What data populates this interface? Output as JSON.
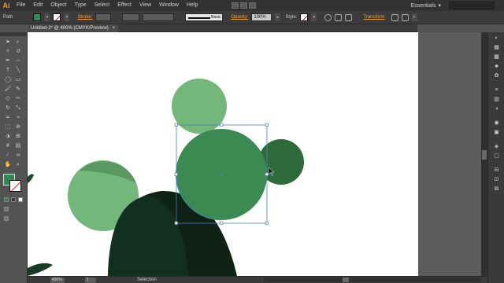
{
  "app": {
    "logo": "Ai"
  },
  "menu": {
    "items": [
      "File",
      "Edit",
      "Object",
      "Type",
      "Select",
      "Effect",
      "View",
      "Window",
      "Help"
    ]
  },
  "workspace": {
    "label": "Essentials",
    "arrow": "▾"
  },
  "control_bar": {
    "selection_type": "Path",
    "stroke_label": "Stroke:",
    "brush_label": "Basic",
    "opacity_label": "Opacity:",
    "opacity_value": "100%",
    "style_label": "Style:",
    "transform_label": "Transform",
    "fill_color": "#2f8a51"
  },
  "document": {
    "tab_title": "Untitled-2* @ 400% (CMYK/Preview)",
    "close_glyph": "×"
  },
  "status": {
    "zoom": "400%",
    "page": "1",
    "tool": "Selection"
  },
  "colors": {
    "light_green": "#74b77a",
    "mid_green": "#3a8a52",
    "dark_green": "#2e6b3a",
    "very_dark_green": "#0f2216",
    "dark_band": "#123020",
    "selection_blue": "#4a7fc1"
  },
  "icons": {
    "tools": [
      "selection-tool-icon",
      "direct-selection-tool-icon",
      "magic-wand-icon",
      "lasso-icon",
      "pen-icon",
      "curvature-icon",
      "type-icon",
      "line-icon",
      "ellipse-icon",
      "rectangle-icon",
      "paintbrush-icon",
      "pencil-icon",
      "eraser-icon",
      "scissors-icon",
      "rotate-icon",
      "scale-icon",
      "width-icon",
      "warp-icon",
      "free-transform-icon",
      "shape-builder-icon",
      "live-paint-icon",
      "perspective-icon",
      "mesh-icon",
      "gradient-icon",
      "eyedropper-icon",
      "blend-icon",
      "symbol-sprayer-icon",
      "graph-icon",
      "artboard-icon",
      "slice-icon",
      "hand-icon",
      "zoom-icon"
    ],
    "dock": [
      "color-icon",
      "color-guide-icon",
      "swatches-icon",
      "brushes-icon",
      "symbols-icon",
      "stroke-icon",
      "gradient-panel-icon",
      "transparency-icon",
      "appearance-icon",
      "graphic-styles-icon",
      "layers-icon",
      "artboards-icon",
      "align-icon",
      "pathfinder-icon",
      "transform-panel-icon"
    ]
  }
}
